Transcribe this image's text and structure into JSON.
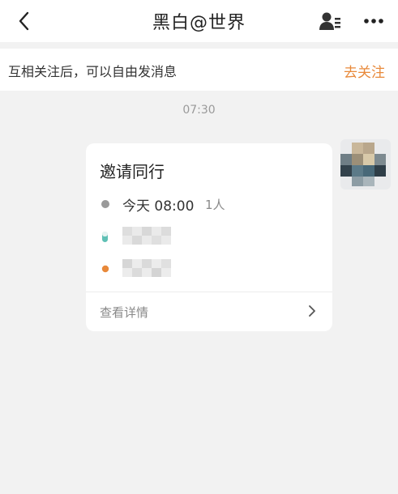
{
  "header": {
    "title": "黑白@世界",
    "back_icon": "chevron-left-icon",
    "contact_icon": "person-card-icon",
    "more_icon": "more-dots-icon"
  },
  "notice": {
    "text": "互相关注后，可以自由发消息",
    "action_label": "去关注",
    "action_color": "#e8893a"
  },
  "chat": {
    "timestamp": "07:30"
  },
  "invite_card": {
    "title": "邀请同行",
    "time": "今天 08:00",
    "count": "1人",
    "detail_link": "查看详情",
    "start_dot_color": "#5fc0b5",
    "end_dot_color": "#e8893a"
  }
}
